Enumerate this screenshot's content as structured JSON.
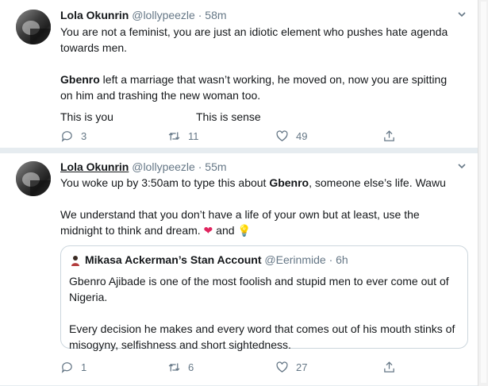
{
  "tweets": [
    {
      "author_name": "Lola Okunrin",
      "author_handle": "@lollypeezle",
      "separator": "·",
      "time": "58m",
      "para1": "You are not a feminist, you are just an idiotic element who pushes hate agenda towards men.",
      "para2_bold": "Gbenro",
      "para2_rest": " left a marriage that wasn’t working, he moved on, now you are spitting on him and trashing the new woman too.",
      "caption_left": "This is you",
      "caption_right": "This is sense",
      "replies": "3",
      "retweets": "11",
      "likes": "49"
    },
    {
      "author_name": "Lola Okunrin",
      "author_handle": "@lollypeezle",
      "separator": "·",
      "time": "55m",
      "para1_pre": "You woke up by 3:50am to type this about ",
      "para1_bold": "Gbenro",
      "para1_post": ", someone else’s life. Wawu",
      "para2_pre": "We understand that you don’t have a life of your own but at least, use the midnight to think and dream. ",
      "para2_and": " and ",
      "emoji1": "❤",
      "emoji2": "💡",
      "quote": {
        "author_name": "Mikasa Ackerman’s Stan Account",
        "author_handle": "@Eerinmide",
        "separator": "·",
        "time": "6h",
        "para1": "Gbenro Ajibade is one of the most foolish and stupid men to ever come out of Nigeria.",
        "para2": "Every decision he makes and every word that comes out of his mouth stinks of misogyny, selfishness and short sightedness."
      },
      "replies": "1",
      "retweets": "6",
      "likes": "27"
    }
  ],
  "icons": [
    "avatar",
    "chevron-down-icon",
    "reply-icon",
    "retweet-icon",
    "like-icon",
    "share-icon"
  ],
  "colors": {
    "muted": "#657786",
    "text": "#14171a",
    "border": "#e6ecf0",
    "heart": "#e0245e"
  }
}
